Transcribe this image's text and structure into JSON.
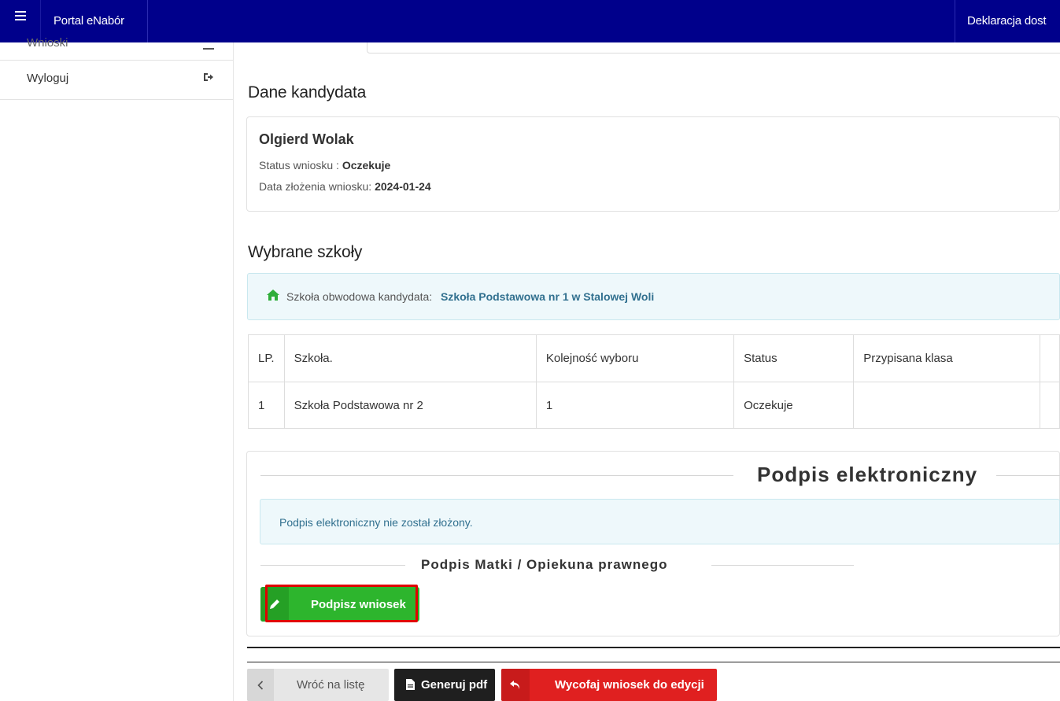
{
  "navbar": {
    "menu_icon": "hamburger-icon",
    "brand": "Portal eNabór",
    "declaration": "Deklaracja dost"
  },
  "sidebar": {
    "items": [
      {
        "label": "Wnioski",
        "icon": "minus-icon"
      },
      {
        "label": "Wyloguj",
        "icon": "sign-out-icon"
      }
    ]
  },
  "candidate": {
    "heading": "Dane kandydata",
    "name": "Olgierd Wolak",
    "status_label": "Status wniosku : ",
    "status_value": "Oczekuje",
    "date_label": "Data złożenia wniosku: ",
    "date_value": "2024-01-24"
  },
  "schools": {
    "heading": "Wybrane szkoły",
    "district_label": "Szkoła obwodowa kandydata: ",
    "district_value": "Szkoła Podstawowa nr 1 w Stalowej Woli",
    "columns": [
      "LP.",
      "Szkoła.",
      "Kolejność wyboru",
      "Status",
      "Przypisana klasa"
    ],
    "rows": [
      [
        "1",
        "Szkoła Podstawowa nr 2",
        "1",
        "Oczekuje",
        ""
      ]
    ]
  },
  "signature": {
    "title": "Podpis elektroniczny",
    "info": "Podpis elektroniczny nie został złożony.",
    "subtitle": "Podpis Matki / Opiekuna prawnego",
    "sign_button": "Podpisz wniosek"
  },
  "actions": {
    "back": "Wróć na listę",
    "pdf": "Generuj pdf",
    "withdraw": "Wycofaj wniosek do edycji"
  },
  "colors": {
    "navbar": "#00008b",
    "success": "#2db52d",
    "danger": "#e02020",
    "dark": "#222222",
    "highlight": "#e00000"
  }
}
